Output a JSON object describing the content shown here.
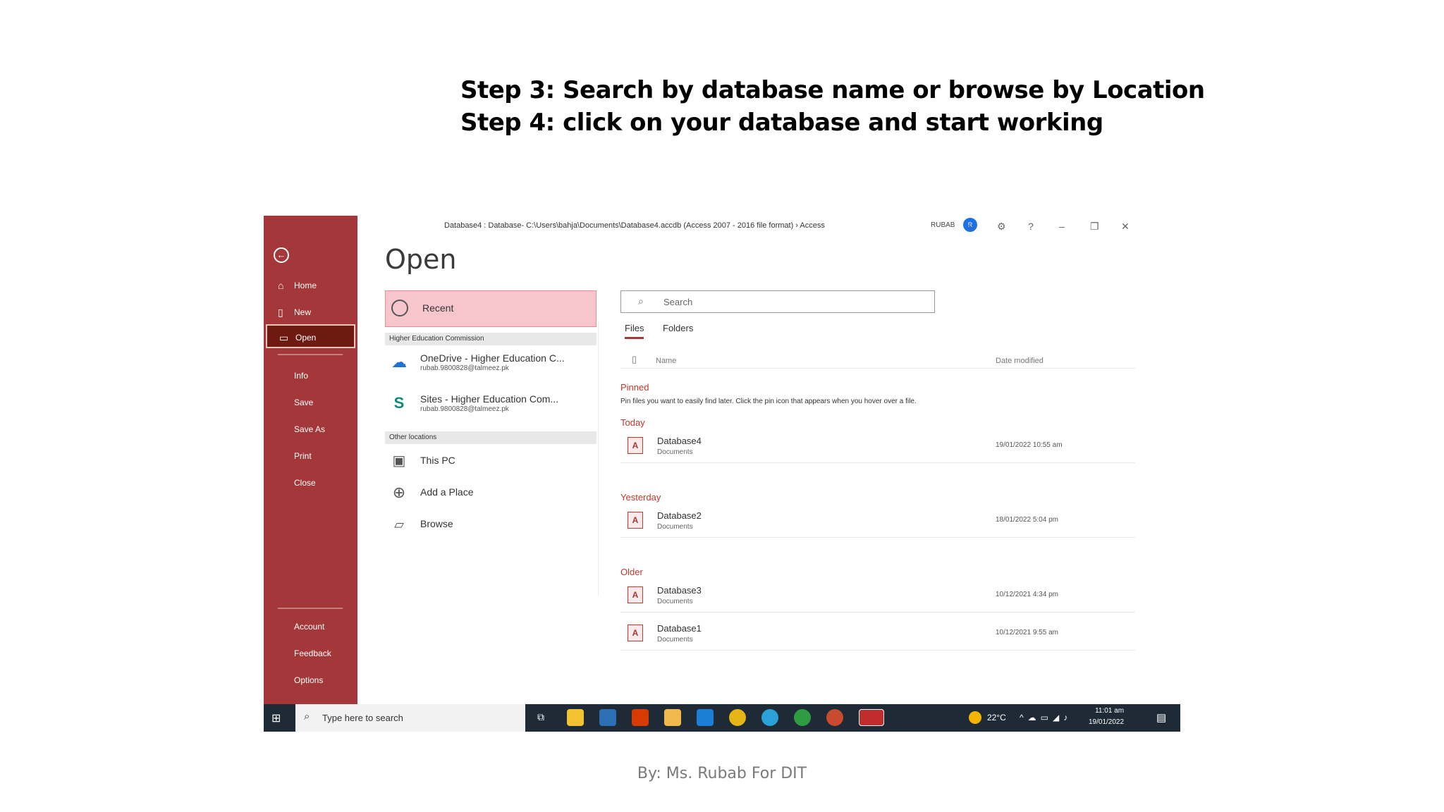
{
  "slide": {
    "line1": "Step 3: Search by database name or browse by Location",
    "line2": "Step 4: click on your database and start working",
    "footer": "By: Ms. Rubab For DIT"
  },
  "window": {
    "title": "Database4 : Database- C:\\Users\\bahja\\Documents\\Database4.accdb (Access 2007 - 2016 file format)  ›  Access",
    "user": "RUBAB",
    "avatar": "R",
    "controls": [
      "smile-icon",
      "settings-icon",
      "help-icon",
      "minimize-icon",
      "restore-icon",
      "close-icon"
    ]
  },
  "backstage": {
    "items": [
      {
        "label": "Home",
        "icon": "home-icon"
      },
      {
        "label": "New",
        "icon": "new-icon"
      },
      {
        "label": "Open",
        "icon": "folder-icon"
      },
      {
        "label": "Info"
      },
      {
        "label": "Save"
      },
      {
        "label": "Save As"
      },
      {
        "label": "Print"
      },
      {
        "label": "Close"
      },
      {
        "label": "Account"
      },
      {
        "label": "Feedback"
      },
      {
        "label": "Options"
      }
    ]
  },
  "main": {
    "heading": "Open",
    "recent": "Recent",
    "section1": "Higher Education Commission",
    "onedrive": {
      "title": "OneDrive - Higher Education C...",
      "sub": "rubab.9800828@talmeez.pk"
    },
    "sites": {
      "title": "Sites - Higher Education Com...",
      "sub": "rubab.9800828@talmeez.pk"
    },
    "section2": "Other locations",
    "this_pc": "This PC",
    "add_place": "Add a Place",
    "browse": "Browse",
    "search_placeholder": "Search",
    "tab_files": "Files",
    "tab_folders": "Folders",
    "col_name": "Name",
    "col_date": "Date modified",
    "pinned": "Pinned",
    "pinned_hint": "Pin files you want to easily find later. Click the pin icon that appears when you hover over a file.",
    "today": "Today",
    "yesterday": "Yesterday",
    "older": "Older",
    "files": [
      {
        "name": "Database4",
        "loc": "Documents",
        "date": "19/01/2022 10:55 am"
      },
      {
        "name": "Database2",
        "loc": "Documents",
        "date": "18/01/2022 5:04 pm"
      },
      {
        "name": "Database3",
        "loc": "Documents",
        "date": "10/12/2021 4:34 pm"
      },
      {
        "name": "Database1",
        "loc": "Documents",
        "date": "10/12/2021 9:55 am"
      }
    ]
  },
  "taskbar": {
    "search_placeholder": "Type here to search",
    "temp": "22°C",
    "time": "11:01 am",
    "date": "19/01/2022"
  }
}
